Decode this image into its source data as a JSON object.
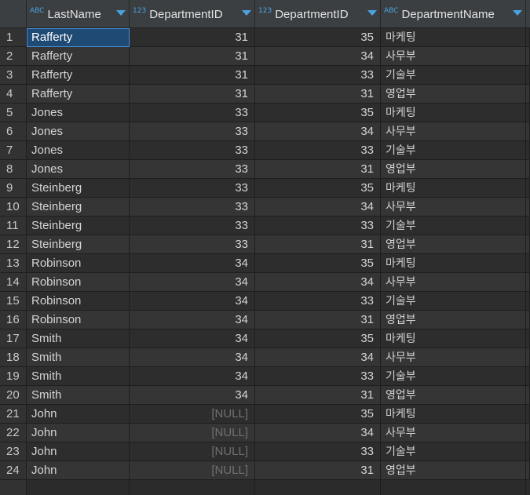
{
  "columns": [
    {
      "type_badge": "ABC",
      "name": "LastName"
    },
    {
      "type_badge": "123",
      "name": "DepartmentID"
    },
    {
      "type_badge": "123",
      "name": "DepartmentID"
    },
    {
      "type_badge": "ABC",
      "name": "DepartmentName"
    }
  ],
  "rows": [
    {
      "n": "1",
      "last": "Rafferty",
      "dept_id": "31",
      "dept_id2": "35",
      "dept_name": "마케팅"
    },
    {
      "n": "2",
      "last": "Rafferty",
      "dept_id": "31",
      "dept_id2": "34",
      "dept_name": "사무부"
    },
    {
      "n": "3",
      "last": "Rafferty",
      "dept_id": "31",
      "dept_id2": "33",
      "dept_name": "기술부"
    },
    {
      "n": "4",
      "last": "Rafferty",
      "dept_id": "31",
      "dept_id2": "31",
      "dept_name": "영업부"
    },
    {
      "n": "5",
      "last": "Jones",
      "dept_id": "33",
      "dept_id2": "35",
      "dept_name": "마케팅"
    },
    {
      "n": "6",
      "last": "Jones",
      "dept_id": "33",
      "dept_id2": "34",
      "dept_name": "사무부"
    },
    {
      "n": "7",
      "last": "Jones",
      "dept_id": "33",
      "dept_id2": "33",
      "dept_name": "기술부"
    },
    {
      "n": "8",
      "last": "Jones",
      "dept_id": "33",
      "dept_id2": "31",
      "dept_name": "영업부"
    },
    {
      "n": "9",
      "last": "Steinberg",
      "dept_id": "33",
      "dept_id2": "35",
      "dept_name": "마케팅"
    },
    {
      "n": "10",
      "last": "Steinberg",
      "dept_id": "33",
      "dept_id2": "34",
      "dept_name": "사무부"
    },
    {
      "n": "11",
      "last": "Steinberg",
      "dept_id": "33",
      "dept_id2": "33",
      "dept_name": "기술부"
    },
    {
      "n": "12",
      "last": "Steinberg",
      "dept_id": "33",
      "dept_id2": "31",
      "dept_name": "영업부"
    },
    {
      "n": "13",
      "last": "Robinson",
      "dept_id": "34",
      "dept_id2": "35",
      "dept_name": "마케팅"
    },
    {
      "n": "14",
      "last": "Robinson",
      "dept_id": "34",
      "dept_id2": "34",
      "dept_name": "사무부"
    },
    {
      "n": "15",
      "last": "Robinson",
      "dept_id": "34",
      "dept_id2": "33",
      "dept_name": "기술부"
    },
    {
      "n": "16",
      "last": "Robinson",
      "dept_id": "34",
      "dept_id2": "31",
      "dept_name": "영업부"
    },
    {
      "n": "17",
      "last": "Smith",
      "dept_id": "34",
      "dept_id2": "35",
      "dept_name": "마케팅"
    },
    {
      "n": "18",
      "last": "Smith",
      "dept_id": "34",
      "dept_id2": "34",
      "dept_name": "사무부"
    },
    {
      "n": "19",
      "last": "Smith",
      "dept_id": "34",
      "dept_id2": "33",
      "dept_name": "기술부"
    },
    {
      "n": "20",
      "last": "Smith",
      "dept_id": "34",
      "dept_id2": "31",
      "dept_name": "영업부"
    },
    {
      "n": "21",
      "last": "John",
      "dept_id": "[NULL]",
      "dept_id2": "35",
      "dept_name": "마케팅"
    },
    {
      "n": "22",
      "last": "John",
      "dept_id": "[NULL]",
      "dept_id2": "34",
      "dept_name": "사무부"
    },
    {
      "n": "23",
      "last": "John",
      "dept_id": "[NULL]",
      "dept_id2": "33",
      "dept_name": "기술부"
    },
    {
      "n": "24",
      "last": "John",
      "dept_id": "[NULL]",
      "dept_id2": "31",
      "dept_name": "영업부"
    }
  ],
  "null_text": "[NULL]",
  "selected_cell": {
    "row": 1,
    "column": "LastName"
  },
  "colors": {
    "accent": "#4aa3df",
    "selection": "#1f4a73",
    "null_text": "#707070"
  }
}
